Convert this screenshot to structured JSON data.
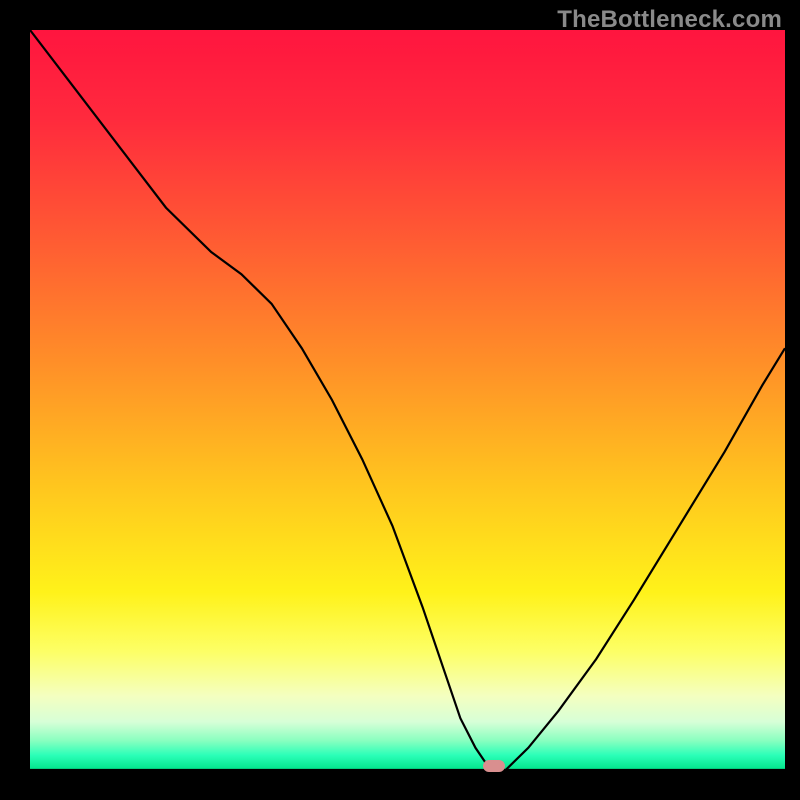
{
  "watermark": "TheBottleneck.com",
  "colors": {
    "background_black": "#000000",
    "curve": "#000000",
    "watermark_text": "#8a8a8a",
    "marker": "#d98f8f",
    "gradient_stops": [
      {
        "pct": 0,
        "color": "#ff153f"
      },
      {
        "pct": 12,
        "color": "#ff2a3d"
      },
      {
        "pct": 28,
        "color": "#ff5a33"
      },
      {
        "pct": 45,
        "color": "#ff8f28"
      },
      {
        "pct": 62,
        "color": "#ffc71e"
      },
      {
        "pct": 76,
        "color": "#fff21a"
      },
      {
        "pct": 84,
        "color": "#fdff66"
      },
      {
        "pct": 90,
        "color": "#f4ffc0"
      },
      {
        "pct": 93.5,
        "color": "#d7ffd7"
      },
      {
        "pct": 96,
        "color": "#8affc0"
      },
      {
        "pct": 98,
        "color": "#2bffb8"
      },
      {
        "pct": 100,
        "color": "#00e58a"
      }
    ]
  },
  "chart_data": {
    "type": "line",
    "title": "",
    "xlabel": "",
    "ylabel": "",
    "xlim": [
      0,
      100
    ],
    "ylim": [
      0,
      100
    ],
    "note": "x, y in percent of plot area; y=0 is top, y=100 is bottom (green optimum). Curve is a bottleneck V shape with minimum near x≈61.",
    "series": [
      {
        "name": "bottleneck-curve",
        "x": [
          0,
          6,
          12,
          18,
          24,
          28,
          32,
          36,
          40,
          44,
          48,
          52,
          55,
          57,
          59,
          61,
          63,
          66,
          70,
          75,
          80,
          86,
          92,
          97,
          100
        ],
        "y": [
          0,
          8,
          16,
          24,
          30,
          33,
          37,
          43,
          50,
          58,
          67,
          78,
          87,
          93,
          97,
          100,
          100,
          97,
          92,
          85,
          77,
          67,
          57,
          48,
          43
        ]
      }
    ],
    "marker": {
      "x": 61.5,
      "y": 100,
      "shape": "rounded-rect"
    },
    "baseline_y": 100
  }
}
